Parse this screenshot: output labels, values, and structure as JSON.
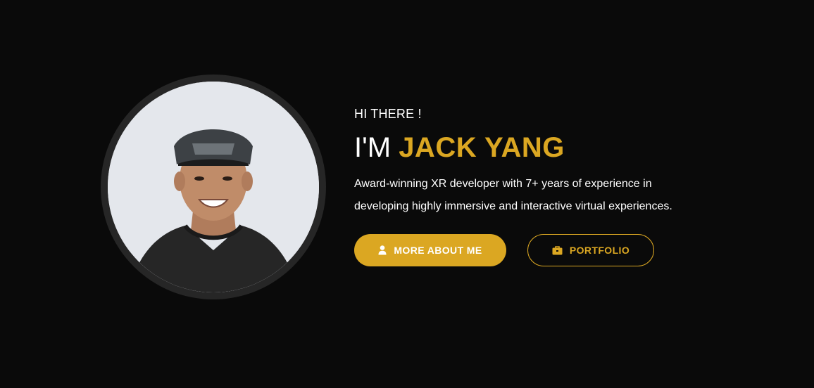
{
  "hero": {
    "greeting": "HI THERE !",
    "headline_prefix": "I'M ",
    "headline_name": "JACK YANG",
    "bio_line1": "Award-winning XR developer with 7+ years of experience in",
    "bio_line2": "developing highly immersive and interactive virtual experiences."
  },
  "buttons": {
    "about_label": "MORE ABOUT ME",
    "about_icon": "user-icon",
    "portfolio_label": "PORTFOLIO",
    "portfolio_icon": "briefcase-icon"
  },
  "colors": {
    "background": "#0a0a0a",
    "accent": "#dba722",
    "text": "#ffffff"
  }
}
